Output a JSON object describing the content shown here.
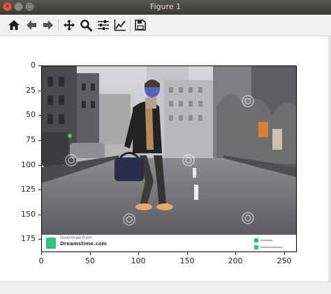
{
  "window": {
    "title": "Figure 1",
    "buttons": {
      "close": "✕",
      "minimize": "–",
      "maximize": "□"
    }
  },
  "toolbar": {
    "tools": [
      {
        "name": "home-icon",
        "glyph": "home"
      },
      {
        "name": "back-arrow-icon",
        "glyph": "back"
      },
      {
        "name": "forward-arrow-icon",
        "glyph": "forward"
      },
      {
        "name": "pan-move-icon",
        "glyph": "move"
      },
      {
        "name": "zoom-magnifier-icon",
        "glyph": "zoom"
      },
      {
        "name": "subplots-sliders-icon",
        "glyph": "sliders"
      },
      {
        "name": "edit-curves-icon",
        "glyph": "chart"
      },
      {
        "name": "save-floppy-icon",
        "glyph": "save"
      }
    ]
  },
  "axes": {
    "y_ticks": [
      "0",
      "25",
      "50",
      "75",
      "100",
      "125",
      "150",
      "175"
    ],
    "x_ticks": [
      "0",
      "50",
      "100",
      "150",
      "200",
      "250"
    ],
    "y_values": [
      0,
      25,
      50,
      75,
      100,
      125,
      150,
      175
    ],
    "x_values": [
      0,
      50,
      100,
      150,
      200,
      250
    ],
    "x_range": [
      0,
      263
    ],
    "y_range": [
      0,
      188
    ]
  },
  "image": {
    "watermark_site": "Dreamstime.com",
    "banner_line1": "Download from",
    "banner_line2": "Dreamstime.com"
  },
  "colors": {
    "titlebar": "#3c3b37",
    "toolbar_bg": "#f2f1ef",
    "banner_accent": "#2ec27e"
  }
}
